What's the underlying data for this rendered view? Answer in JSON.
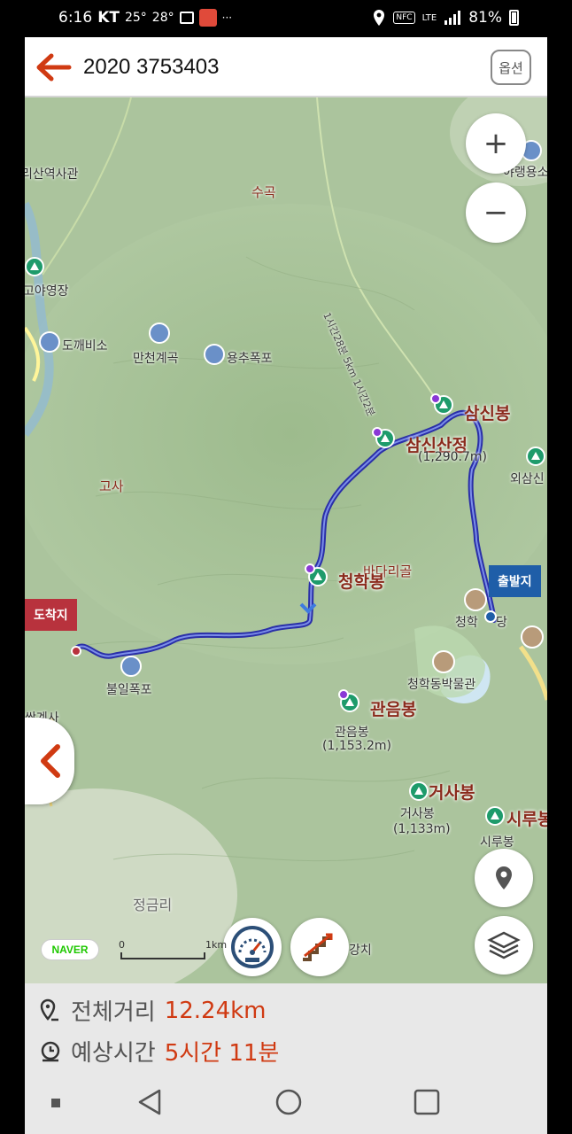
{
  "status_bar": {
    "time": "6:16",
    "carrier": "KT",
    "temp_now": "25°",
    "temp_high": "28°",
    "more": "···",
    "nfc": "NFC",
    "lte": "LTE",
    "battery": "81%"
  },
  "header": {
    "title": "2020 3753403",
    "option_label": "옵션"
  },
  "map": {
    "places": {
      "museum": "리산역사관",
      "sugok": "수곡",
      "campsite": "고야영장",
      "dokkaebi": "도깨비소",
      "mancheon": "만천계곡",
      "yongchu": "용추폭포",
      "yarang": "야랭용소",
      "gosa": "고사",
      "waesam": "외삼신",
      "badari": "바다리골",
      "cheonghak_temple": "청학",
      "cheonghak_temple2": "당",
      "museum2": "청학동박물관",
      "bulil": "불일폭포",
      "ssanggye": "쌍계사",
      "jeonggeum": "정금리",
      "gangchi": "강치"
    },
    "peaks": {
      "samsinbong": "삼신봉",
      "samsinsanjeong": "삼신산정",
      "samsin_alt": "(1,290.7m)",
      "cheonghakbong": "청학봉",
      "gwaneumbong": "관음봉",
      "gwaneum_small": "관음봉",
      "gwaneum_alt": "(1,153.2m)",
      "geosabong": "거사봉",
      "geosa_small": "거사봉",
      "geosa_alt": "(1,133m)",
      "sirubong": "시루봉",
      "siru_small": "시루봉"
    },
    "trail_note": "1시간28분 5km 1시간2분",
    "flags": {
      "arrival": "도착지",
      "departure": "출발지"
    },
    "scale": {
      "start": "0",
      "end": "1km"
    },
    "naver": "NAVER",
    "colors": {
      "route": "#2a2fa8",
      "terrain": "#a9c39a",
      "accent": "#d03a12"
    }
  },
  "controls": {
    "zoom_in": "+",
    "zoom_out": "−"
  },
  "summary": {
    "distance_label": "전체거리",
    "distance_value": "12.24km",
    "time_label": "예상시간",
    "time_value": "5시간 11분"
  }
}
